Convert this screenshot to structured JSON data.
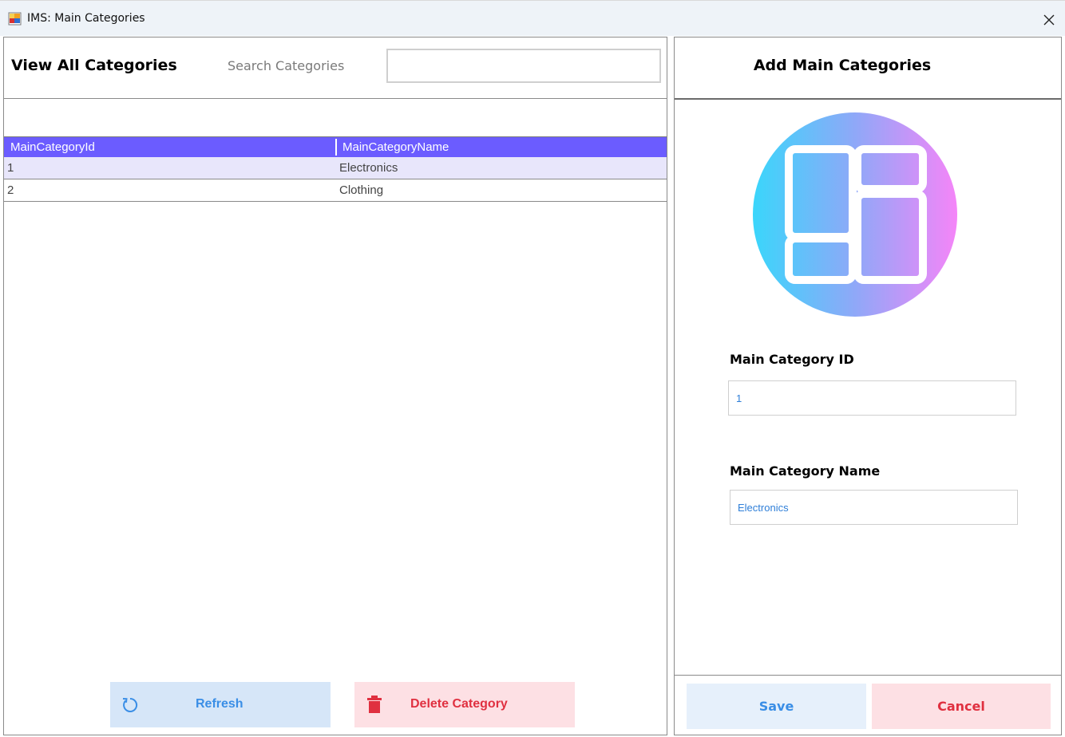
{
  "window": {
    "title": "IMS: Main Categories",
    "app_icon": "windows-forms-app-icon",
    "close_icon": "close-icon"
  },
  "left": {
    "title": "View All Categories",
    "search_label": "Search Categories",
    "search_value": "",
    "grid": {
      "columns": [
        "MainCategoryId",
        "MainCategoryName"
      ],
      "rows": [
        {
          "id": "1",
          "name": "Electronics",
          "selected": true
        },
        {
          "id": "2",
          "name": "Clothing",
          "selected": false
        }
      ],
      "header_color": "#6b5cff"
    },
    "refresh_label": "Refresh",
    "refresh_icon": "refresh-icon",
    "delete_label": "Delete Category",
    "delete_icon": "trash-icon"
  },
  "right": {
    "title": "Add Main Categories",
    "illustration_icon": "category-grid-icon",
    "id_label": "Main Category ID",
    "id_value": "1",
    "name_label": "Main Category Name",
    "name_value": "Electronics",
    "save_label": "Save",
    "cancel_label": "Cancel"
  },
  "colors": {
    "accent_blue": "#3a8ee6",
    "danger_red": "#e03040",
    "grid_header": "#6b5cff"
  }
}
